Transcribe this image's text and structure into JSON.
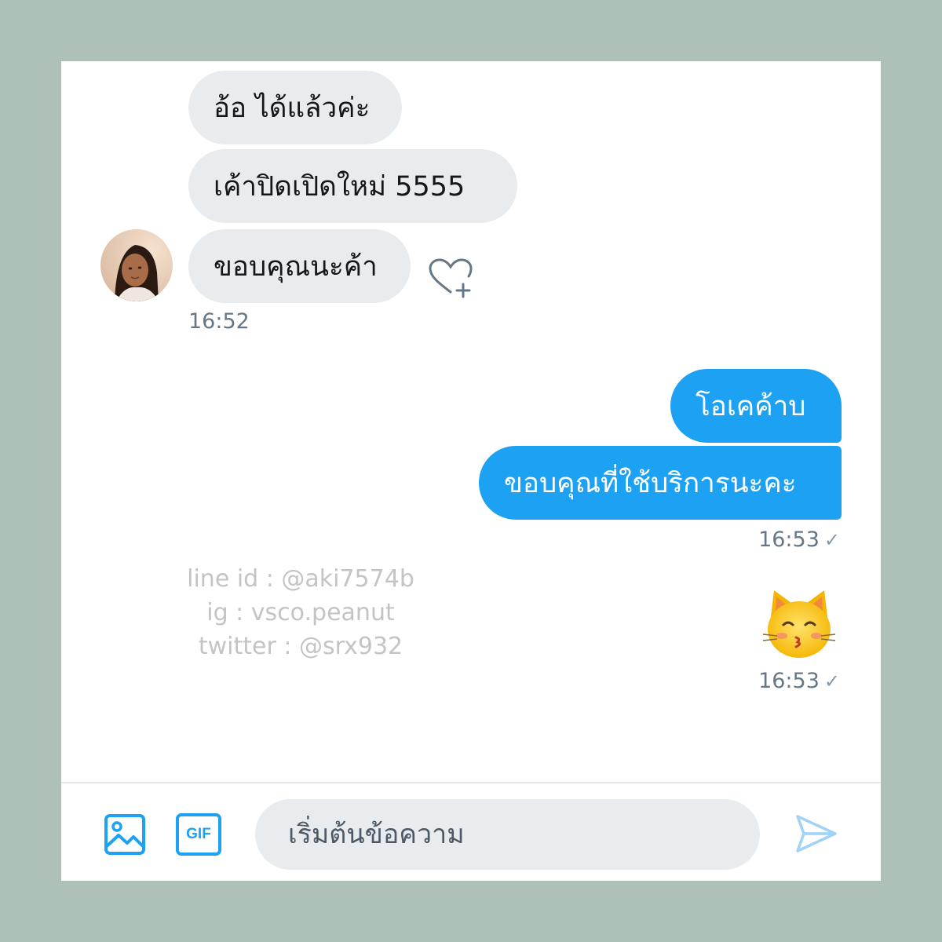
{
  "conversation": {
    "incoming": [
      {
        "text": "อ้อ ได้แล้วค่ะ"
      },
      {
        "text": "เค้าปิดเปิดใหม่ 5555"
      },
      {
        "text": "ขอบคุณนะค้า"
      }
    ],
    "incoming_time": "16:52",
    "outgoing": [
      {
        "text": "โอเคค้าบ"
      },
      {
        "text": "ขอบคุณที่ใช้บริการนะคะ"
      }
    ],
    "outgoing_time": "16:53",
    "emoji_message": "😽",
    "emoji_time": "16:53"
  },
  "watermark": {
    "line1": "line id : @aki7574b",
    "line2": "ig : vsco.peanut",
    "line3": "twitter : @srx932"
  },
  "composer": {
    "placeholder": "เริ่มต้นข้อความ",
    "icons": [
      "image-icon",
      "gif-icon",
      "send-icon"
    ],
    "gif_label": "GIF"
  },
  "colors": {
    "accent": "#1da1f2",
    "incoming_bubble": "#e8ecef",
    "background": "#adc1b6"
  }
}
